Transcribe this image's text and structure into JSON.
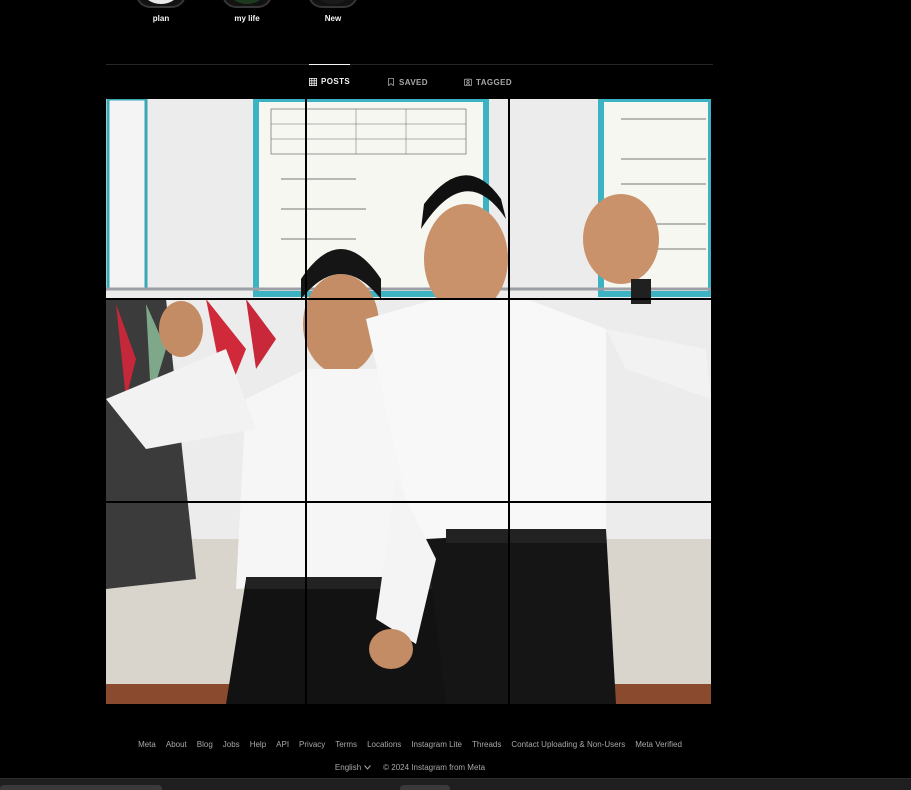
{
  "highlights": [
    {
      "label": "plan",
      "color": "#e8e8e8"
    },
    {
      "label": "my life",
      "color": "#1e3a1e"
    },
    {
      "label": "New",
      "color": "#1a1a1a"
    }
  ],
  "tabs": [
    {
      "label": "POSTS",
      "icon": "grid-icon",
      "active": true
    },
    {
      "label": "SAVED",
      "icon": "bookmark-icon",
      "active": false
    },
    {
      "label": "TAGGED",
      "icon": "tag-person-icon",
      "active": false
    }
  ],
  "footer": {
    "links": [
      "Meta",
      "About",
      "Blog",
      "Jobs",
      "Help",
      "API",
      "Privacy",
      "Terms",
      "Locations",
      "Instagram Lite",
      "Threads",
      "Contact Uploading & Non-Users",
      "Meta Verified"
    ],
    "language": "English",
    "copyright": "© 2024 Instagram from Meta"
  },
  "colors": {
    "background": "#000000",
    "text": "#f5f5f5",
    "muted": "#a8a8a8",
    "divider": "#262626"
  }
}
